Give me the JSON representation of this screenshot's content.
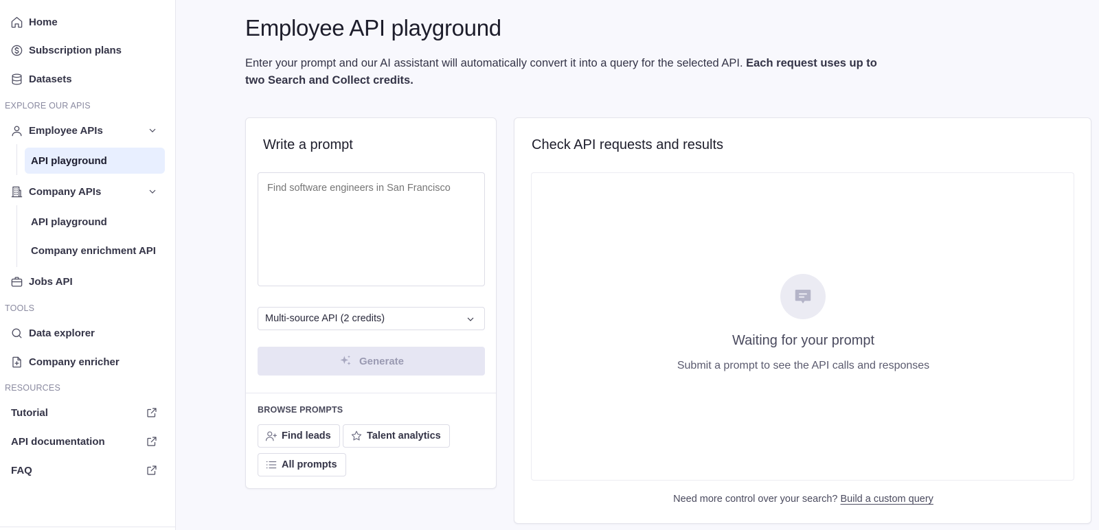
{
  "sidebar": {
    "home": "Home",
    "subscription_plans": "Subscription plans",
    "datasets": "Datasets",
    "explore_label": "EXPLORE OUR APIS",
    "employee_apis": "Employee APIs",
    "employee_sub": [
      "API playground"
    ],
    "company_apis": "Company APIs",
    "company_sub": [
      "API playground",
      "Company enrichment API"
    ],
    "jobs_api": "Jobs API",
    "tools_label": "TOOLS",
    "data_explorer": "Data explorer",
    "company_enricher": "Company enricher",
    "resources_label": "RESOURCES",
    "tutorial": "Tutorial",
    "api_documentation": "API documentation",
    "faq": "FAQ"
  },
  "main": {
    "title": "Employee API playground",
    "desc_plain": "Enter your prompt and our AI assistant will automatically convert it into a query for the selected API. ",
    "desc_bold": "Each request uses up to two Search and Collect credits."
  },
  "prompt_card": {
    "title": "Write a prompt",
    "placeholder": "Find software engineers in San Francisco",
    "api_select": "Multi-source API (2 credits)",
    "generate": "Generate",
    "browse_label": "BROWSE PROMPTS",
    "chips": [
      "Find leads",
      "Talent analytics",
      "All prompts"
    ]
  },
  "results_card": {
    "title": "Check API requests and results",
    "waiting_title": "Waiting for your prompt",
    "waiting_sub": "Submit a prompt to see the API calls and responses",
    "footer_text": "Need more control over your search? ",
    "footer_link": "Build a custom query"
  },
  "colors": {
    "active_nav_bg": "#e8efff",
    "generate_disabled_bg": "#e6e6f3",
    "page_bg": "#f8f8fd"
  }
}
